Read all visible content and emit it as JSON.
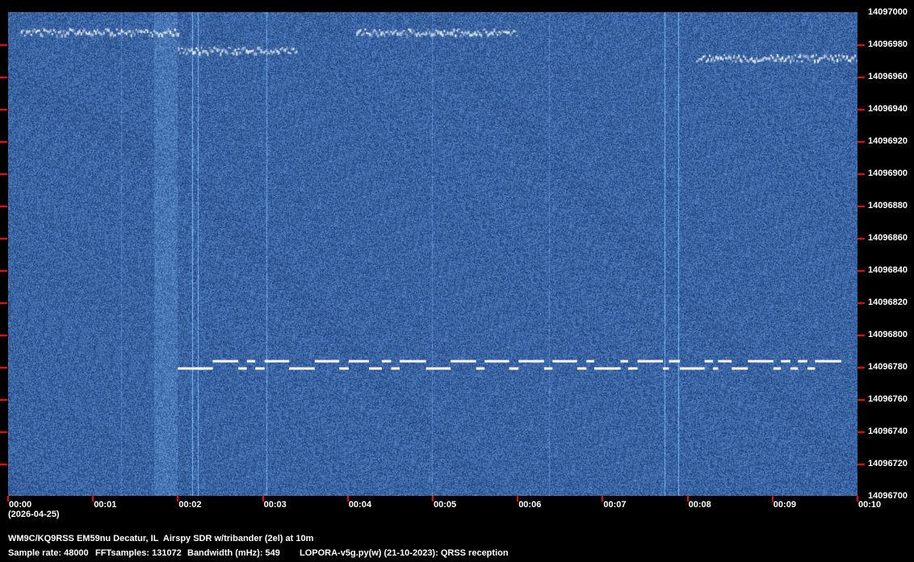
{
  "chart_data": {
    "type": "heatmap",
    "subtype": "spectrogram-waterfall",
    "x_axis": {
      "unit": "minutes",
      "range": [
        0,
        10
      ],
      "tick_labels": [
        "00:00",
        "00:01",
        "00:02",
        "00:03",
        "00:04",
        "00:05",
        "00:06",
        "00:07",
        "00:08",
        "00:09",
        "00:10"
      ],
      "date_label": "(2026-04-25)"
    },
    "y_axis": {
      "unit": "Hz",
      "range": [
        14096700,
        14097000
      ],
      "tick_labels": [
        "14097000",
        "14096980",
        "14096960",
        "14096940",
        "14096920",
        "14096900",
        "14096880",
        "14096860",
        "14096840",
        "14096820",
        "14096800",
        "14096780",
        "14096760",
        "14096740",
        "14096720",
        "14096700"
      ]
    },
    "colors": {
      "background": "#0a2a6a",
      "signal": "#ffffff",
      "ticks": "#ff0000"
    },
    "signal": {
      "low_hz": 14096779,
      "high_hz": 14096783.5,
      "start_level": "low",
      "transitions_min": [
        2.0,
        2.41,
        2.71,
        2.81,
        2.91,
        3.02,
        3.31,
        3.61,
        3.9,
        4.01,
        4.25,
        4.4,
        4.51,
        4.61,
        4.92,
        5.21,
        5.51,
        5.61,
        5.9,
        6.01,
        6.31,
        6.41,
        6.7,
        6.81,
        6.9,
        7.21,
        7.3,
        7.41,
        7.71,
        7.78,
        7.91,
        8.2,
        8.3,
        8.36,
        8.52,
        8.71,
        9.01,
        9.1,
        9.21,
        9.3,
        9.41,
        9.5,
        9.81
      ]
    },
    "other_signals": [
      {
        "t": [
          0.15,
          2.0
        ],
        "hz": 14096988
      },
      {
        "t": [
          4.1,
          6.0
        ],
        "hz": 14096988
      },
      {
        "t": [
          8.1,
          10.0
        ],
        "hz": 14096972
      },
      {
        "t": [
          2.0,
          3.4
        ],
        "hz": 14096977
      }
    ]
  },
  "footer": {
    "line1": "WM9C/KQ9RSS EM59nu Decatur, IL  Airspy SDR w/tribander (2el) at 10m",
    "line2_items": [
      "Sample rate: 48000",
      "FFTsamples: 131072",
      "Bandwidth (mHz): 549",
      "LOPORA-v5g.py(w) (21-10-2023): QRSS reception"
    ]
  }
}
